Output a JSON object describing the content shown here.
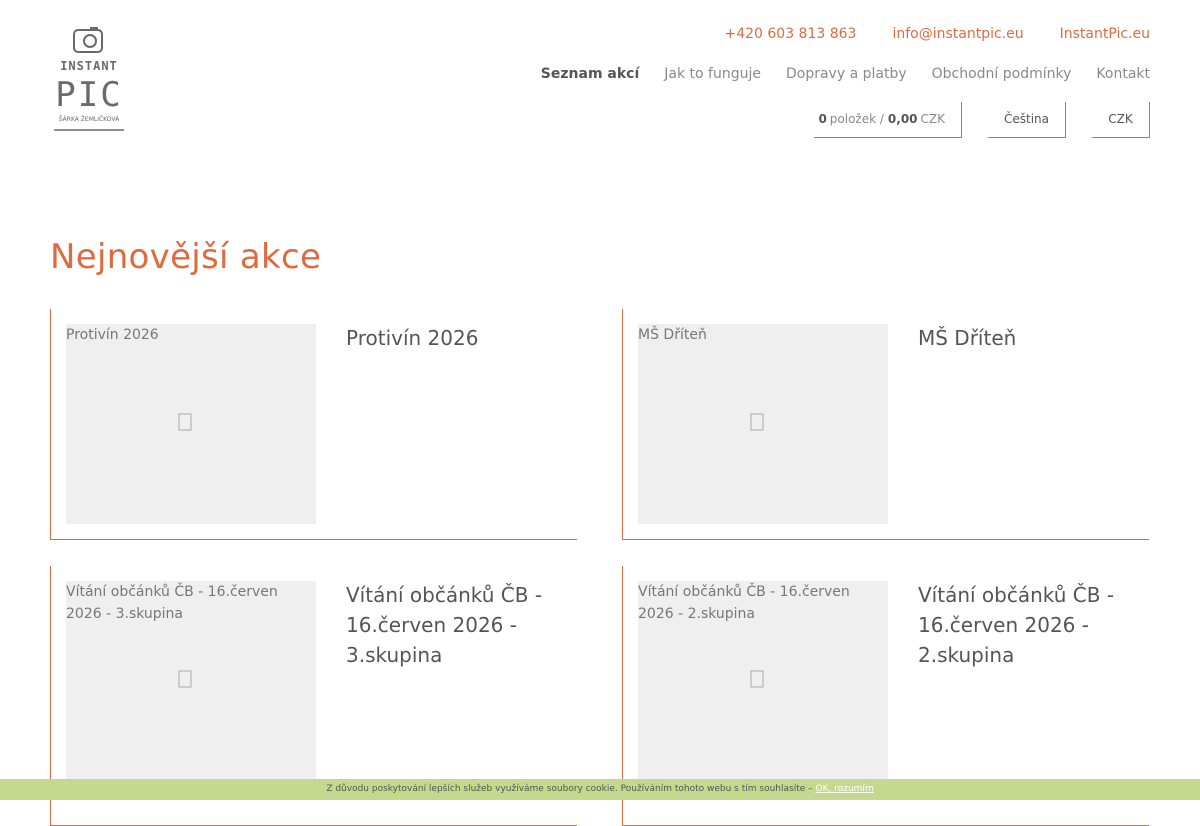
{
  "brand": {
    "logo_top": "INSTANT",
    "logo_main": "PIC",
    "logo_sub": "ŠÁRKA ŽEMLIČKOVÁ"
  },
  "header": {
    "phone": "+420 603 813 863",
    "email": "info@instantpic.eu",
    "site": "InstantPic.eu"
  },
  "nav": {
    "items": [
      "Seznam akcí",
      "Jak to funguje",
      "Dopravy a platby",
      "Obchodní podmínky",
      "Kontakt"
    ]
  },
  "cart": {
    "count": "0",
    "items_label": "položek /",
    "total": "0,00",
    "currency": "CZK"
  },
  "language": "Čeština",
  "currency": "CZK",
  "page_title": "Nejnovější akce",
  "events": [
    {
      "alt": "Protivín 2026",
      "title": "Protivín 2026"
    },
    {
      "alt": "MŠ Dříteň",
      "title": "MŠ Dříteň"
    },
    {
      "alt": "Vítání občánků ČB - 16.červen 2026 - 3.skupina",
      "title": "Vítání občánků ČB - 16.červen 2026 - 3.skupina"
    },
    {
      "alt": "Vítání občánků ČB - 16.červen 2026 - 2.skupina",
      "title": "Vítání občánků ČB - 16.červen 2026 - 2.skupina"
    }
  ],
  "cookie": {
    "text": "Z důvodu poskytování lepších služeb využíváme soubory cookie. Používáním tohoto webu s tím souhlasíte –",
    "ok": "OK, rozumím"
  },
  "colors": {
    "accent": "#dd6b3f",
    "cookie_bg": "#c5d98e",
    "thumb_bg": "#efefef"
  }
}
